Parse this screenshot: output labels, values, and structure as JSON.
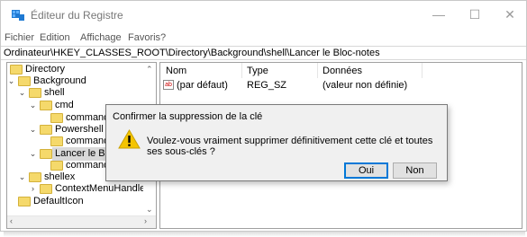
{
  "window": {
    "title": "Éditeur du Registre"
  },
  "menu": [
    "Fichier",
    "Edition",
    "Affichage",
    "Favoris",
    "?"
  ],
  "address": "Ordinateur\\HKEY_CLASSES_ROOT\\Directory\\Background\\shell\\Lancer le Bloc-notes",
  "tree": {
    "nodes": [
      {
        "label": "Directory"
      },
      {
        "label": "Background"
      },
      {
        "label": "shell"
      },
      {
        "label": "cmd"
      },
      {
        "label": "command"
      },
      {
        "label": "Powershell"
      },
      {
        "label": "command"
      },
      {
        "label": "Lancer le Bloc-notes"
      },
      {
        "label": "command"
      },
      {
        "label": "shellex"
      },
      {
        "label": "ContextMenuHandlers"
      },
      {
        "label": "DefaultIcon"
      }
    ]
  },
  "list": {
    "columns": [
      "Nom",
      "Type",
      "Données"
    ],
    "rows": [
      {
        "name": "(par défaut)",
        "type": "REG_SZ",
        "data": "(valeur non définie)",
        "icon": "string-value-icon"
      }
    ]
  },
  "dialog": {
    "title": "Confirmer la suppression de la clé",
    "message": "Voulez-vous vraiment supprimer définitivement cette clé et toutes ses sous-clés ?",
    "yes": "Oui",
    "no": "Non",
    "icon": "warning-icon"
  },
  "colors": {
    "warning": "#f4c400",
    "selection": "#d9d9d9",
    "accent": "#0078d7",
    "folder": "#f5d96b",
    "app_icon": "#1f7ad3"
  }
}
